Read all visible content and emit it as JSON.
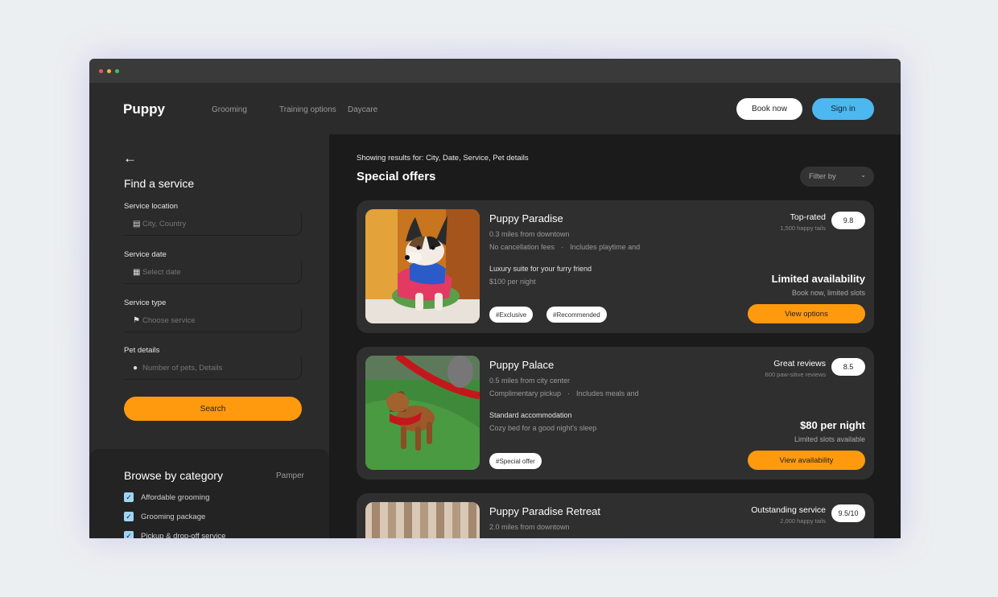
{
  "nav": {
    "brand": "Puppy",
    "links": [
      "Grooming",
      "Training options",
      "Daycare"
    ],
    "book_label": "Book now",
    "signin_label": "Sign in"
  },
  "sidebar": {
    "title": "Find a service",
    "fields": [
      {
        "label": "Service location",
        "placeholder": "City, Country",
        "icon": "map-icon"
      },
      {
        "label": "Service date",
        "placeholder": "Select date",
        "icon": "calendar-icon"
      },
      {
        "label": "Service type",
        "placeholder": "Choose service",
        "icon": "dog-icon"
      },
      {
        "label": "Pet details",
        "placeholder": "Number of pets, Details",
        "icon": "person-icon"
      }
    ],
    "search_label": "Search",
    "category": {
      "title": "Browse by category",
      "pamper": "Pamper",
      "items": [
        "Affordable grooming",
        "Grooming package",
        "Pickup & drop-off service"
      ]
    }
  },
  "main": {
    "results_line": "Showing results for: City, Date, Service, Pet details",
    "title": "Special offers",
    "filter_label": "Filter by",
    "cards": [
      {
        "name": "Puppy Paradise",
        "distance": "0.3 miles from downtown",
        "feature1": "No cancellation fees",
        "feature2": "Includes playtime and",
        "room": "Luxury suite for your furry friend",
        "price_line": "$100 per night",
        "tags": [
          "#Exclusive",
          "#Recommended"
        ],
        "rating_label": "Top-rated",
        "rating_sub": "1,500 happy tails",
        "rating": "9.8",
        "avail_title": "Limited availability",
        "avail_sub": "Book now, limited slots",
        "button": "View options"
      },
      {
        "name": "Puppy Palace",
        "distance": "0.5 miles from city center",
        "feature1": "Complimentary pickup",
        "feature2": "Includes meals and",
        "room": "Standard accommodation",
        "price_line": "Cozy bed for a good night's sleep",
        "tags": [
          "#Special offer"
        ],
        "rating_label": "Great reviews",
        "rating_sub": "600 paw-sitive reviews",
        "rating": "8.5",
        "avail_title": "$80 per night",
        "avail_sub": "Limited slots available",
        "button": "View availability"
      },
      {
        "name": "Puppy Paradise Retreat",
        "distance": "2.0 miles from downtown",
        "rating_label": "Outstanding service",
        "rating_sub": "2,000 happy tails",
        "rating": "9.5/10"
      }
    ]
  }
}
